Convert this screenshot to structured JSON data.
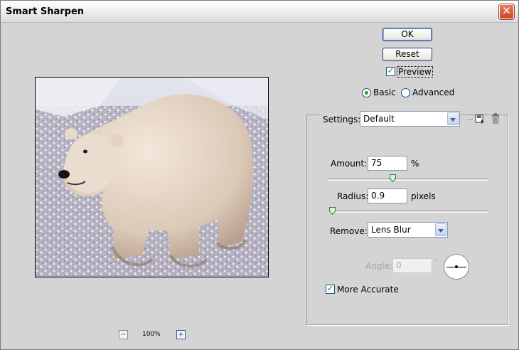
{
  "window": {
    "title": "Smart Sharpen",
    "close_label": "✕"
  },
  "buttons": {
    "ok_label": "OK",
    "reset_label": "Reset"
  },
  "preview": {
    "label": "Preview",
    "checked": true
  },
  "mode": {
    "basic_label": "Basic",
    "advanced_label": "Advanced",
    "selected": "Basic"
  },
  "settings": {
    "label": "Settings:",
    "value": "Default"
  },
  "amount": {
    "label": "Amount:",
    "value": "75",
    "unit": "%",
    "fraction": 0.4
  },
  "radius": {
    "label": "Radius:",
    "value": "0.9",
    "unit": "pixels",
    "fraction": 0.0
  },
  "remove": {
    "label": "Remove:",
    "value": "Lens Blur"
  },
  "angle": {
    "label": "Angle:",
    "value": "0",
    "unit": "°"
  },
  "more_accurate": {
    "label": "More Accurate",
    "checked": true
  },
  "zoom": {
    "level": "100%",
    "minus_label": "−",
    "plus_label": "+"
  },
  "colors": {
    "check_green": "#21a121",
    "button_border": "#1c3c7e",
    "close_red": "#d2543a"
  }
}
